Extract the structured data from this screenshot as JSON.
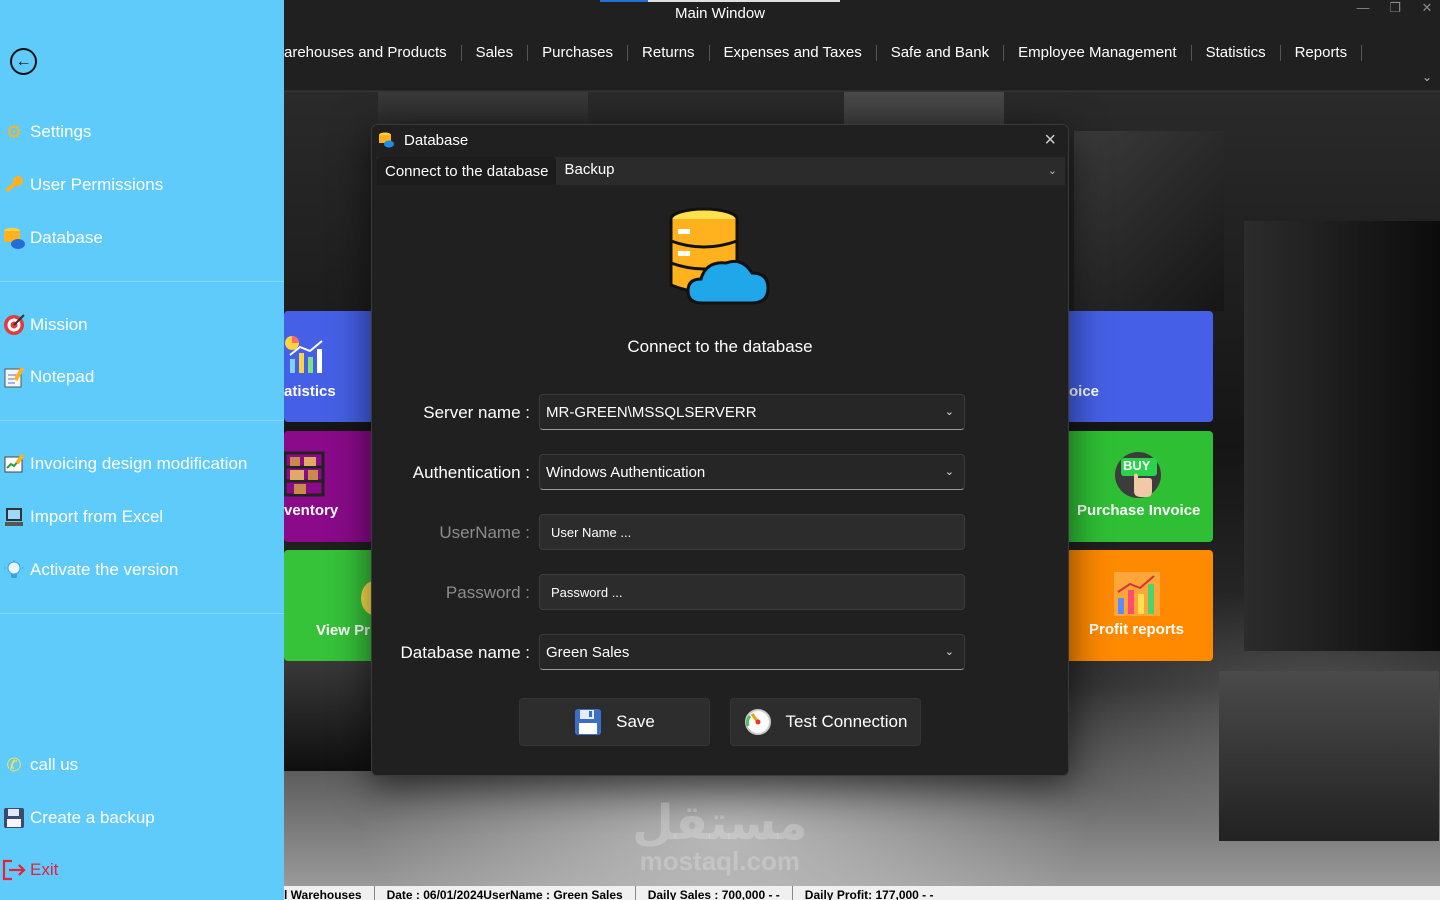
{
  "window": {
    "title": "Main Window",
    "controls": [
      "—",
      "❐",
      "✕"
    ]
  },
  "menu": {
    "items": [
      "arehouses and Products",
      "Sales",
      "Purchases",
      "Returns",
      "Expenses and Taxes",
      "Safe and Bank",
      "Employee Management",
      "Statistics",
      "Reports"
    ]
  },
  "sidebar": {
    "items": [
      {
        "label": "Settings",
        "icon": "gear-icon"
      },
      {
        "label": "User Permissions",
        "icon": "key-icon"
      },
      {
        "label": "Database",
        "icon": "database-icon"
      },
      {
        "label": "Mission",
        "icon": "target-icon"
      },
      {
        "label": "Notepad",
        "icon": "notepad-icon"
      },
      {
        "label": "Invoicing design modification",
        "icon": "invoice-edit-icon"
      },
      {
        "label": "Import from Excel",
        "icon": "computer-icon"
      },
      {
        "label": "Activate the version",
        "icon": "lightbulb-icon"
      },
      {
        "label": "call us",
        "icon": "phone-icon"
      },
      {
        "label": "Create a backup",
        "icon": "floppy-icon"
      },
      {
        "label": "Exit",
        "icon": "exit-icon"
      }
    ]
  },
  "tiles": {
    "statistics": "atistics",
    "inventory": "ventory",
    "view": "View Pr",
    "invoice": "oice",
    "purchase": "Purchase Invoice",
    "purchase_badge": "BUY",
    "profit": "Profit reports"
  },
  "modal": {
    "title": "Database",
    "tabs": [
      "Connect to the database",
      "Backup"
    ],
    "heading": "Connect to the database",
    "server_label": "Server name :",
    "server_value": "MR-GREEN\\MSSQLSERVERR",
    "auth_label": "Authentication :",
    "auth_value": "Windows Authentication",
    "username_label": "UserName :",
    "username_placeholder": "User Name ...",
    "password_label": "Password :",
    "password_placeholder": "Password ...",
    "dbname_label": "Database name :",
    "dbname_value": "Green Sales",
    "save_label": "Save",
    "test_label": "Test Connection"
  },
  "watermark": {
    "arabic": "مستقل",
    "latin": "mostaql.com"
  },
  "statusbar": {
    "segments": [
      "l Warehouses",
      "Date : 06/01/2024UserName : Green Sales",
      "Daily Sales : 700,000 - -",
      "Daily Profit: 177,000 - -"
    ]
  },
  "colors": {
    "sidebar": "#5ecbfa",
    "modal_bg": "#202020",
    "tile_blue": "#4560e6",
    "tile_green": "#2fbf35",
    "tile_orange": "#ff8a00",
    "tile_purple": "#8a0a8a"
  }
}
